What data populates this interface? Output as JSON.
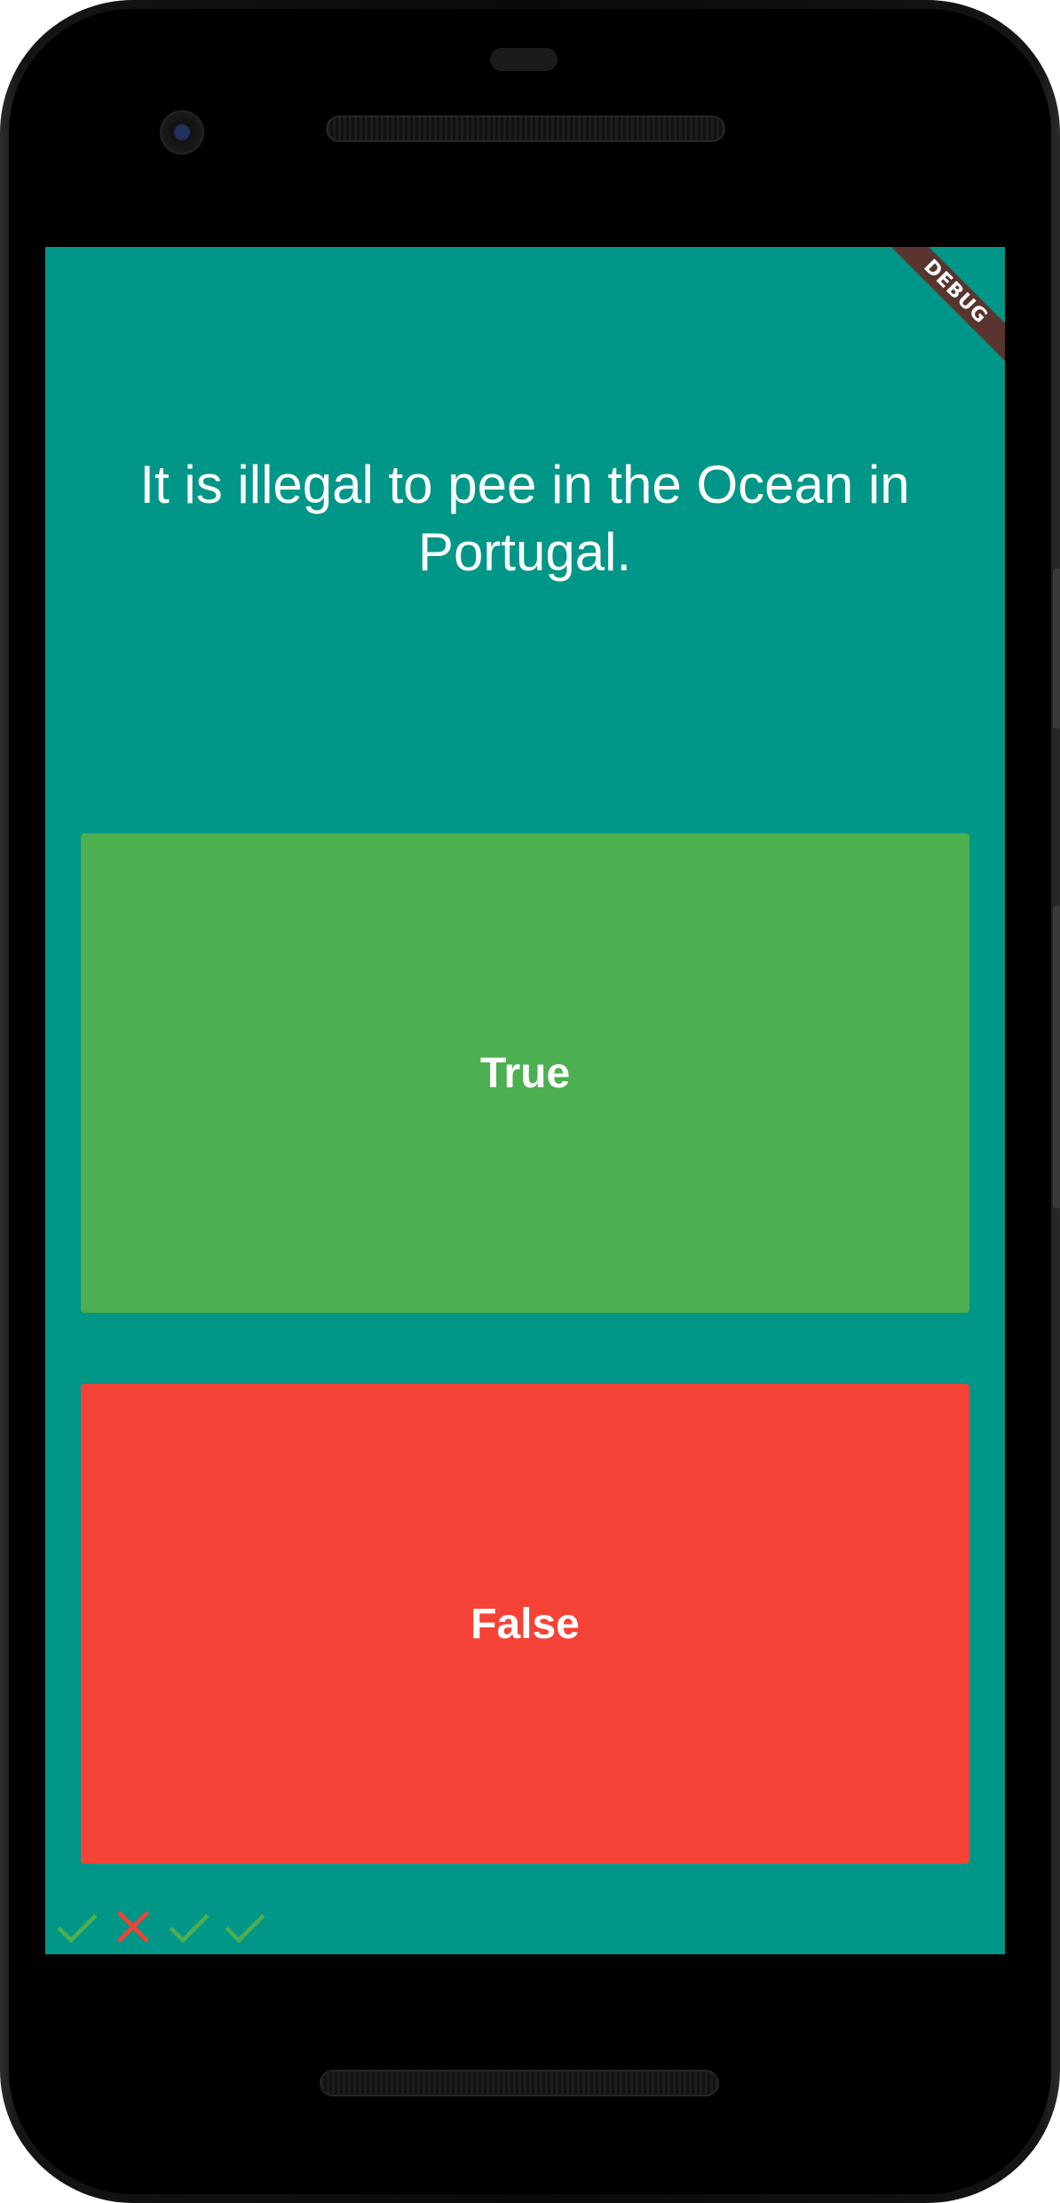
{
  "debug_banner": {
    "label": "DEBUG"
  },
  "quiz": {
    "question": "It is illegal to pee in the Ocean in Portugal.",
    "true_label": "True",
    "false_label": "False"
  },
  "colors": {
    "background": "#009688",
    "true_button": "#4caf50",
    "false_button": "#f44336",
    "correct_icon": "#4caf50",
    "wrong_icon": "#f44336"
  },
  "score_keeper": [
    {
      "icon": "check-icon",
      "result": "correct"
    },
    {
      "icon": "close-icon",
      "result": "wrong"
    },
    {
      "icon": "check-icon",
      "result": "correct"
    },
    {
      "icon": "check-icon",
      "result": "correct"
    }
  ]
}
